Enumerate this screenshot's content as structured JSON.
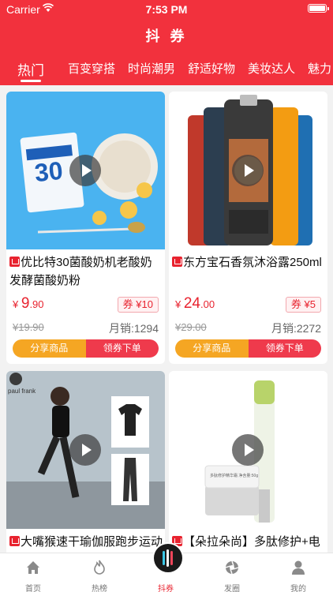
{
  "status": {
    "carrier": "Carrier",
    "time": "7:53 PM"
  },
  "header": {
    "title": "抖 券"
  },
  "tabs": [
    {
      "label": "热门"
    },
    {
      "label": "百变穿搭"
    },
    {
      "label": "时尚潮男"
    },
    {
      "label": "舒适好物"
    },
    {
      "label": "美妆达人"
    },
    {
      "label": "魅力"
    }
  ],
  "products": [
    {
      "name": "优比特30菌酸奶机老酸奶发酵菌酸奶粉",
      "price_symbol": "¥",
      "price_int": "9",
      "price_dec": ".90",
      "coupon_label": "券",
      "coupon_value": "¥10",
      "original_price": "¥19.90",
      "sales": "月销:1294",
      "share_label": "分享商品",
      "buy_label": "领券下单"
    },
    {
      "name": "东方宝石香氛沐浴露250ml",
      "price_symbol": "¥",
      "price_int": "24",
      "price_dec": ".00",
      "coupon_label": "券",
      "coupon_value": "¥5",
      "original_price": "¥29.00",
      "sales": "月销:2272",
      "share_label": "分享商品",
      "buy_label": "领券下单"
    },
    {
      "name": "大嘴猴速干瑜伽服跑步运动",
      "brand_logo_text": "paul frank"
    },
    {
      "name": "【朵拉朵尚】多肽修护+电",
      "package_text": "多肽修护精华霜 净含量:50g"
    }
  ],
  "tabbar": [
    {
      "label": "首页",
      "icon": "home-icon"
    },
    {
      "label": "热榜",
      "icon": "flame-icon"
    },
    {
      "label": "抖券",
      "icon": "coupon-icon"
    },
    {
      "label": "发圈",
      "icon": "aperture-icon"
    },
    {
      "label": "我的",
      "icon": "user-icon"
    }
  ],
  "colors": {
    "brand_red": "#f2313d",
    "price_red": "#e8232f",
    "share_orange": "#f5a623",
    "buy_red": "#ef3a4c"
  }
}
